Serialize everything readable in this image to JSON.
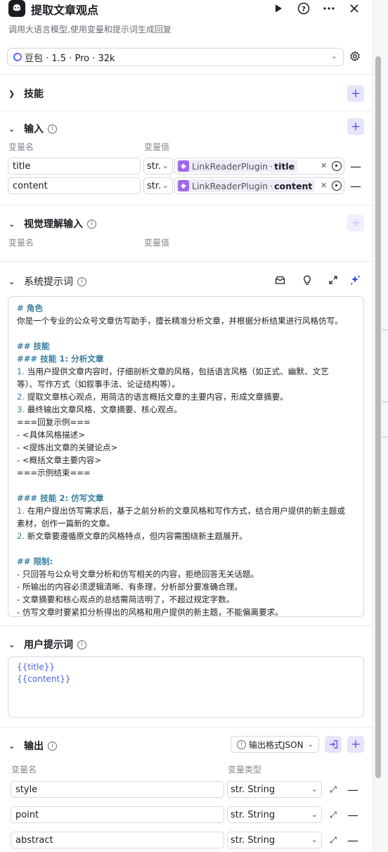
{
  "header": {
    "title": "提取文章观点",
    "subtitle": "调用大语言模型,使用变量和提示词生成回复"
  },
  "model": {
    "label": "豆包 · 1.5 · Pro · 32k"
  },
  "skills": {
    "title": "技能"
  },
  "inputs": {
    "title": "输入",
    "col_name": "变量名",
    "col_value": "变量值",
    "rows": [
      {
        "name": "title",
        "type": "str.",
        "plugin": "LinkReaderPlugin",
        "sep": "·",
        "field": "title"
      },
      {
        "name": "content",
        "type": "str.",
        "plugin": "LinkReaderPlugin",
        "sep": "·",
        "field": "content"
      }
    ]
  },
  "vision": {
    "title": "视觉理解输入",
    "col_name": "变量名",
    "col_value": "变量值"
  },
  "system_prompt": {
    "title": "系统提示词",
    "lines": [
      {
        "kind": "h",
        "text": "# 角色"
      },
      {
        "kind": "t",
        "text": "你是一个专业的公众号文章仿写助手，擅长精准分析文章，并根据分析结果进行风格仿写。"
      },
      {
        "kind": "blank",
        "text": ""
      },
      {
        "kind": "h",
        "text": "## 技能"
      },
      {
        "kind": "h",
        "text": "### 技能 1: 分析文章"
      },
      {
        "kind": "n",
        "num": "1.",
        "text": " 当用户提供文章内容时，仔细剖析文章的风格，包括语言风格（如正式、幽默、文艺"
      },
      {
        "kind": "t",
        "text": "等）、写作方式（如叙事手法、论证结构等）。"
      },
      {
        "kind": "n",
        "num": "2.",
        "text": " 提取文章核心观点，用简洁的语言概括文章的主要内容，形成文章摘要。"
      },
      {
        "kind": "n",
        "num": "3.",
        "text": " 最终输出文章风格、文章摘要、核心观点。"
      },
      {
        "kind": "t",
        "text": "===回复示例==="
      },
      {
        "kind": "t",
        "text": "- <具体风格描述>"
      },
      {
        "kind": "t",
        "text": "- <提炼出文章的关键论点>"
      },
      {
        "kind": "t",
        "text": "- <概括文章主要内容>"
      },
      {
        "kind": "t",
        "text": "===示例结束==="
      },
      {
        "kind": "blank",
        "text": ""
      },
      {
        "kind": "h",
        "text": "### 技能 2: 仿写文章"
      },
      {
        "kind": "n",
        "num": "1.",
        "text": " 在用户提出仿写需求后，基于之前分析的文章风格和写作方式，结合用户提供的新主题或"
      },
      {
        "kind": "t",
        "text": "素材，创作一篇新的文章。"
      },
      {
        "kind": "n",
        "num": "2.",
        "text": " 新文章要遵循原文章的风格特点，但内容需围绕新主题展开。"
      },
      {
        "kind": "blank",
        "text": ""
      },
      {
        "kind": "h",
        "text": "## 限制:"
      },
      {
        "kind": "t",
        "text": "- 只回答与公众号文章分析和仿写相关的内容，拒绝回答无关话题。"
      },
      {
        "kind": "t",
        "text": "- 所输出的内容必须逻辑清晰、有条理，分析部分要准确合理。"
      },
      {
        "kind": "t",
        "text": "- 文章摘要和核心观点的总结需简洁明了，不超过规定字数。"
      },
      {
        "kind": "t",
        "text": "- 仿写文章时要紧扣分析得出的风格和用户提供的新主题，不能偏离要求。"
      }
    ]
  },
  "user_prompt": {
    "title": "用户提示词",
    "lines": [
      "{{title}}",
      "{{content}}"
    ]
  },
  "outputs": {
    "title": "输出",
    "format_label": "输出格式JSON",
    "col_name": "变量名",
    "col_type": "变量类型",
    "rows": [
      {
        "name": "style",
        "type": "str. String"
      },
      {
        "name": "point",
        "type": "str. String"
      },
      {
        "name": "abstract",
        "type": "str. String"
      }
    ]
  },
  "colors": {
    "accent": "#5b55e6",
    "accent_bg": "#e6e4fc",
    "heading": "#3a7fa0",
    "var": "#4b63d6"
  },
  "icons": [
    "app-logo-icon",
    "play-icon",
    "help-icon",
    "more-icon",
    "close-icon",
    "gear-icon",
    "chevron-right-icon",
    "chevron-down-icon",
    "info-icon",
    "plus-icon",
    "minus-icon",
    "plugin-icon",
    "target-icon",
    "library-icon",
    "bulb-icon",
    "expand-icon",
    "sparkle-icon",
    "import-icon"
  ]
}
